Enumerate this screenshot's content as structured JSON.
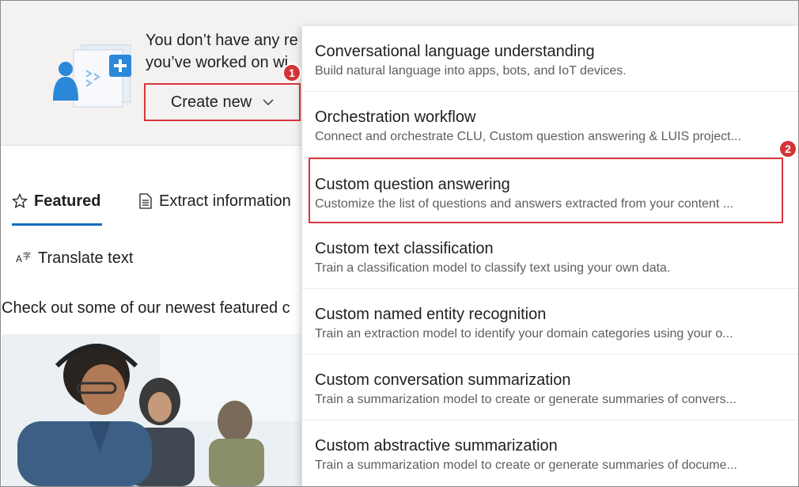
{
  "banner": {
    "line1": "You don’t have any re",
    "line2": "you’ve worked on wi",
    "create_label": "Create new"
  },
  "steps": {
    "one": "1",
    "two": "2"
  },
  "tabs": {
    "featured": "Featured",
    "extract": "Extract information",
    "translate": "Translate text"
  },
  "promo_text": "Check out some of our newest featured c",
  "menu": {
    "items": [
      {
        "title": "Conversational language understanding",
        "desc": "Build natural language into apps, bots, and IoT devices."
      },
      {
        "title": "Orchestration workflow",
        "desc": "Connect and orchestrate CLU, Custom question answering & LUIS project..."
      },
      {
        "title": "Custom question answering",
        "desc": "Customize the list of questions and answers extracted from your content ..."
      },
      {
        "title": "Custom text classification",
        "desc": "Train a classification model to classify text using your own data."
      },
      {
        "title": "Custom named entity recognition",
        "desc": "Train an extraction model to identify your domain categories using your o..."
      },
      {
        "title": "Custom conversation summarization",
        "desc": "Train a summarization model to create or generate summaries of convers..."
      },
      {
        "title": "Custom abstractive summarization",
        "desc": "Train a summarization model to create or generate summaries of docume..."
      }
    ]
  },
  "colors": {
    "accent": "#0f6cbd",
    "highlight_border": "#d9363e",
    "badge": "#d13438"
  }
}
